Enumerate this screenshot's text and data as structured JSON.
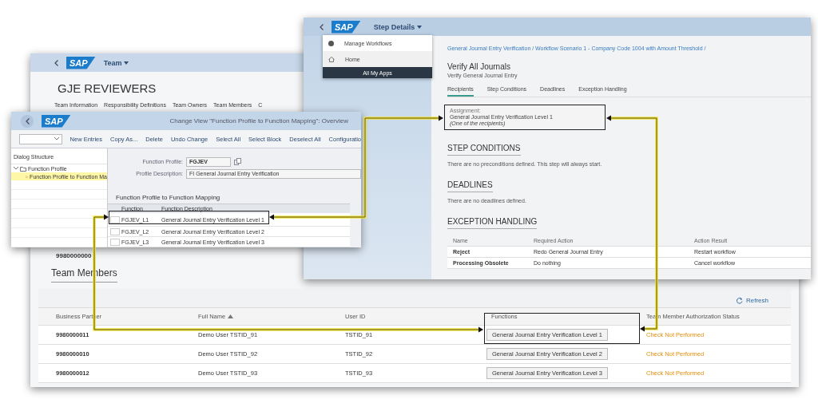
{
  "team_window": {
    "logo": "SAP",
    "title": "Team",
    "heading": "GJE REVIEWERS",
    "tabs": [
      {
        "label": "Team Information"
      },
      {
        "label": "Responsibility Definitions"
      },
      {
        "label": "Team Owners"
      },
      {
        "label": "Team Members"
      },
      {
        "label": "C"
      }
    ],
    "owners_table": {
      "rows": [
        {
          "business_partner": "9980000000"
        }
      ]
    },
    "members": {
      "title": "Team Members",
      "refresh": "Refresh",
      "columns": [
        {
          "label": "Business Partner",
          "sorted": false
        },
        {
          "label": "Full Name",
          "sorted": true
        },
        {
          "label": "User ID",
          "sorted": false
        },
        {
          "label": "Functions",
          "sorted": false
        },
        {
          "label": "Team Member Authorization Status",
          "sorted": false
        }
      ],
      "rows": [
        {
          "business_partner": "9980000011",
          "full_name": "Demo User TSTID_91",
          "user_id": "TSTID_91",
          "function": "General Journal Entry Verification Level 1",
          "status": "Check Not Performed"
        },
        {
          "business_partner": "9980000010",
          "full_name": "Demo User TSTID_92",
          "user_id": "TSTID_92",
          "function": "General Journal Entry Verification Level 2",
          "status": "Check Not Performed"
        },
        {
          "business_partner": "9980000012",
          "full_name": "Demo User TSTID_93",
          "user_id": "TSTID_93",
          "function": "General Journal Entry Verification Level 3",
          "status": "Check Not Performed"
        }
      ]
    }
  },
  "gui_window": {
    "logo": "SAP",
    "title": "Change View \"Function Profile to Function Mapping\": Overview",
    "toolbar": [
      "New Entries",
      "Copy As...",
      "Delete",
      "Undo Change",
      "Select All",
      "Select Block",
      "Deselect All",
      "Configuratio"
    ],
    "dialog_structure": {
      "title": "Dialog Structure",
      "tree": [
        {
          "label": "Function Profile",
          "expanded": true,
          "selected": false,
          "children": [
            {
              "label": "Function Profile to Function Ma",
              "selected": true
            }
          ]
        }
      ]
    },
    "fields": [
      {
        "label": "Function Profile:",
        "value": "FGJEV"
      },
      {
        "label": "Profile Description:",
        "value": "FI General Journal Entry Verification"
      }
    ],
    "mapping": {
      "title": "Function Profile to Function Mapping",
      "columns": [
        "Function",
        "Function Description"
      ],
      "rows": [
        {
          "function": "FGJEV_L1",
          "description": "General Journal Entry Verification Level 1"
        },
        {
          "function": "FGJEV_L2",
          "description": "General Journal Entry Verification Level 2"
        },
        {
          "function": "FGJEV_L3",
          "description": "General Journal Entry Verification Level 3"
        }
      ]
    }
  },
  "step_window": {
    "logo": "SAP",
    "title": "Step Details",
    "menu": {
      "items": [
        "Manage Workflows",
        "Home"
      ],
      "footer": "All My Apps"
    },
    "breadcrumb": "General Journal Entry Verification / Workflow Scenario 1 - Company Code 1004 with Amount Threshold /",
    "heading": "Verify All Journals",
    "subtitle": "Verify General Journal Entry",
    "tabs": [
      {
        "label": "Recipients",
        "selected": true
      },
      {
        "label": "Step Conditions",
        "selected": false
      },
      {
        "label": "Deadlines",
        "selected": false
      },
      {
        "label": "Exception Handling",
        "selected": false
      }
    ],
    "assignment": {
      "label": "Assignment:",
      "value": "General Journal Entry Verification Level 1",
      "note": "(One of the recipients)"
    },
    "step_conditions": {
      "title": "STEP CONDITIONS",
      "text": "There are no preconditions defined. This step will always start."
    },
    "deadlines": {
      "title": "DEADLINES",
      "text": "There are no deadlines defined."
    },
    "exception_handling": {
      "title": "EXCEPTION HANDLING",
      "columns": [
        "Name",
        "Required Action",
        "Action Result"
      ],
      "rows": [
        [
          "Reject",
          "Redo General Journal Entry",
          "Restart workflow"
        ],
        [
          "Processing Obsolete",
          "Do nothing",
          "Cancel workflow"
        ]
      ]
    }
  }
}
